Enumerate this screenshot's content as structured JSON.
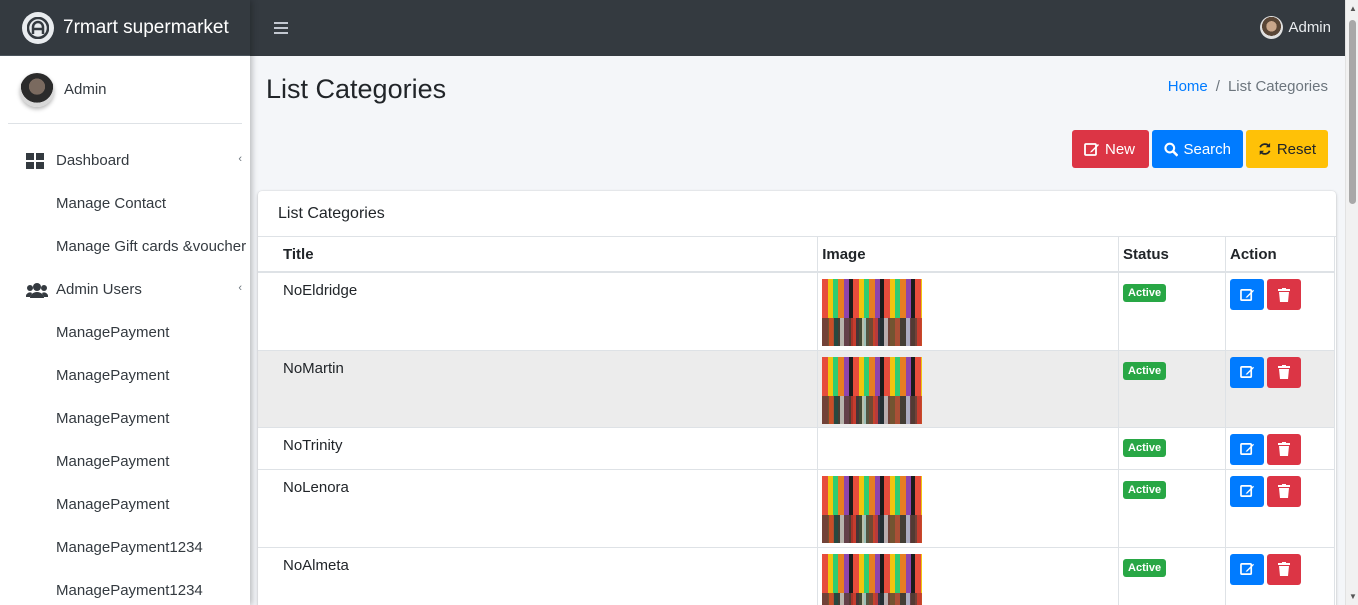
{
  "brand": {
    "name": "7rmart supermarket"
  },
  "sidebar": {
    "user_name": "Admin",
    "items": [
      {
        "label": "Dashboard",
        "icon": "dashboard-icon",
        "sub": false,
        "caret": true
      },
      {
        "label": "Manage Contact",
        "sub": true
      },
      {
        "label": "Manage Gift cards &voucher",
        "sub": true
      },
      {
        "label": "Admin Users",
        "icon": "users-icon",
        "sub": false,
        "caret": true
      },
      {
        "label": "ManagePayment",
        "sub": true
      },
      {
        "label": "ManagePayment",
        "sub": true
      },
      {
        "label": "ManagePayment",
        "sub": true
      },
      {
        "label": "ManagePayment",
        "sub": true
      },
      {
        "label": "ManagePayment",
        "sub": true
      },
      {
        "label": "ManagePayment1234",
        "sub": true
      },
      {
        "label": "ManagePayment1234",
        "sub": true
      }
    ]
  },
  "topbar": {
    "user_name": "Admin"
  },
  "page": {
    "title": "List Categories",
    "breadcrumb": {
      "home": "Home",
      "separator": "/",
      "current": "List Categories"
    }
  },
  "buttons": {
    "new": "New",
    "search": "Search",
    "reset": "Reset"
  },
  "card": {
    "title": "List Categories",
    "columns": [
      "Title",
      "Image",
      "Status",
      "Action"
    ],
    "rows": [
      {
        "title": "NoEldridge",
        "has_image": true,
        "status": "Active"
      },
      {
        "title": "NoMartin",
        "has_image": true,
        "status": "Active"
      },
      {
        "title": "NoTrinity",
        "has_image": false,
        "status": "Active"
      },
      {
        "title": "NoLenora",
        "has_image": true,
        "status": "Active"
      },
      {
        "title": "NoAlmeta",
        "has_image": true,
        "status": "Active"
      }
    ]
  },
  "colors": {
    "primary": "#007bff",
    "danger": "#dc3545",
    "warning": "#ffc107",
    "success": "#28a745",
    "dark": "#343a40"
  }
}
